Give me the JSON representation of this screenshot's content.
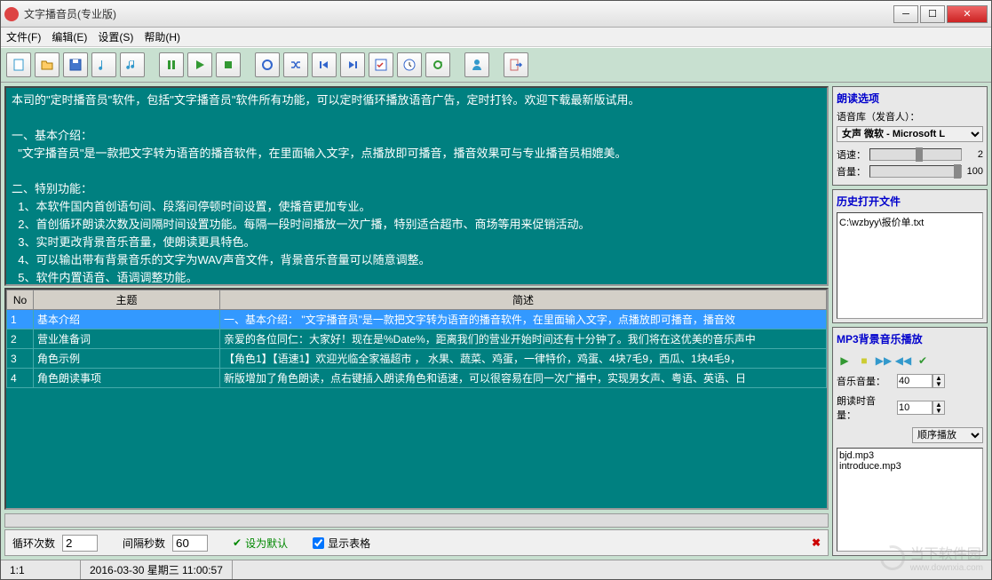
{
  "window": {
    "title": "文字播音员(专业版)"
  },
  "menu": {
    "file": "文件(F)",
    "edit": "编辑(E)",
    "settings": "设置(S)",
    "help": "帮助(H)"
  },
  "text_content": "本司的\"定时播音员\"软件，包括\"文字播音员\"软件所有功能，可以定时循环播放语音广告，定时打铃。欢迎下载最新版试用。\n\n一、基本介绍：\n  \"文字播音员\"是一款把文字转为语音的播音软件，在里面输入文字，点播放即可播音，播音效果可与专业播音员相媲美。\n\n二、特别功能：\n  1、本软件国内首创语句间、段落间停顿时间设置，使播音更加专业。\n  2、首创循环朗读次数及间隔时间设置功能。每隔一段时间播放一次广播，特别适合超市、商场等用来促销活动。\n  3、实时更改背景音乐音量，使朗读更具特色。\n  4、可以输出带有背景音乐的文字为WAV声音文件，背景音乐音量可以随意调整。\n  5、软件内置语音、语调调整功能。",
  "table": {
    "headers": {
      "no": "No",
      "topic": "主题",
      "desc": "简述"
    },
    "rows": [
      {
        "no": "1",
        "topic": "基本介绍",
        "desc": "一、基本介绍：    \"文字播音员\"是一款把文字转为语音的播音软件，在里面输入文字，点播放即可播音，播音效"
      },
      {
        "no": "2",
        "topic": "营业准备词",
        "desc": "亲爱的各位同仁：大家好！现在是%Date%，距离我们的营业开始时间还有十分钟了。我们将在这优美的音乐声中"
      },
      {
        "no": "3",
        "topic": "角色示例",
        "desc": "【角色1】【语速1】欢迎光临全家福超市 ， 水果、蔬菜、鸡蛋，一律特价，鸡蛋、4块7毛9，西瓜、1块4毛9，"
      },
      {
        "no": "4",
        "topic": "角色朗读事项",
        "desc": "新版增加了角色朗读，点右键插入朗读角色和语速，可以很容易在同一次广播中，实现男女声、粤语、英语、日"
      }
    ]
  },
  "bottom": {
    "loop_label": "循环次数",
    "loop_val": "2",
    "interval_label": "间隔秒数",
    "interval_val": "60",
    "set_default": "设为默认",
    "show_table": "显示表格"
  },
  "status": {
    "pos": "1:1",
    "datetime": "2016-03-30 星期三 11:00:57"
  },
  "read_opts": {
    "title": "朗读选项",
    "voice_label": "语音库（发音人）：",
    "voice_sel": "女声 微软 - Microsoft L",
    "speed_label": "语速：",
    "speed_val": "2",
    "volume_label": "音量：",
    "volume_val": "100"
  },
  "history": {
    "title": "历史打开文件",
    "items": [
      "C:\\wzbyy\\报价单.txt"
    ]
  },
  "mp3": {
    "title": "MP3背景音乐播放",
    "music_vol_label": "音乐音量：",
    "music_vol": "40",
    "read_vol_label": "朗读时音量：",
    "read_vol": "10",
    "mode": "顺序播放",
    "files": [
      "bjd.mp3",
      "introduce.mp3"
    ]
  },
  "watermark": {
    "text": "当下软件园",
    "url": "www.downxia.com"
  }
}
